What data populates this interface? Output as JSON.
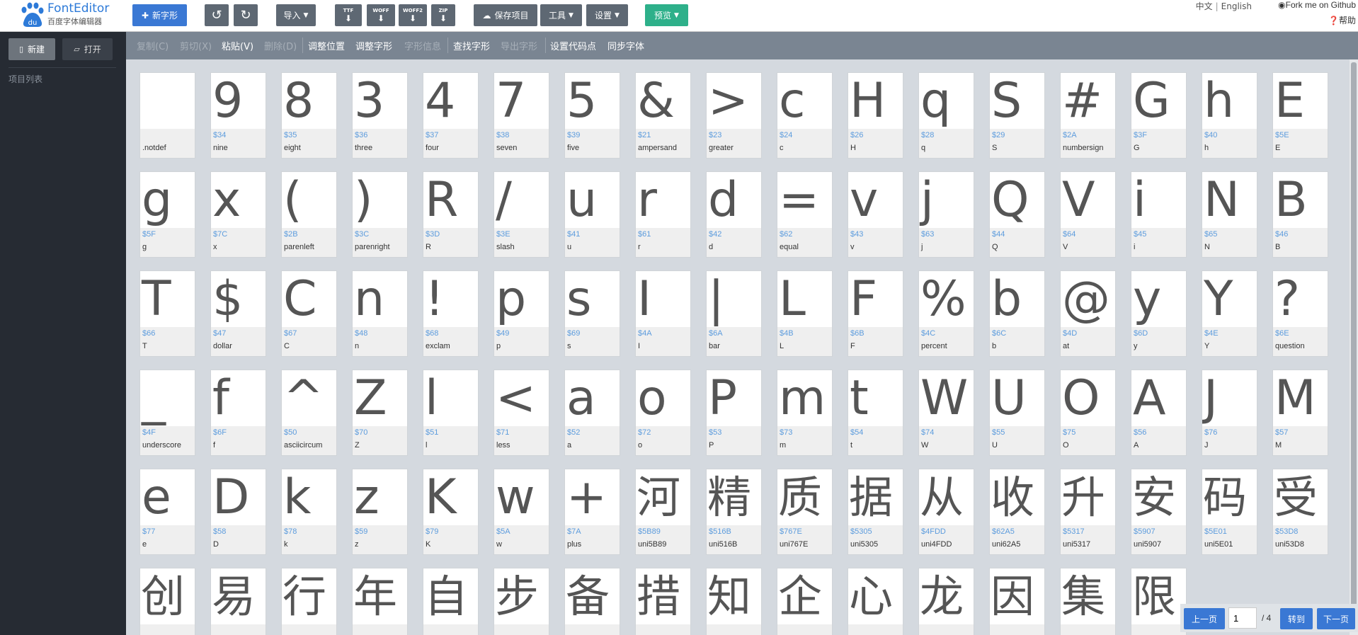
{
  "brand": {
    "name": "FontEditor",
    "subtitle": "百度字体编辑器"
  },
  "toolbar": {
    "new_glyph": "新字形",
    "undo_icon": "undo-icon",
    "redo_icon": "redo-icon",
    "import": "导入",
    "export_ttf": {
      "format": "TTF"
    },
    "export_woff": {
      "format": "WOFF"
    },
    "export_woff2": {
      "format": "WOFF2"
    },
    "export_zip": {
      "format": "ZIP"
    },
    "save_project": "保存项目",
    "tools": "工具",
    "settings": "设置",
    "preview": "预览"
  },
  "header_right": {
    "lang_cn": "中文",
    "lang_sep": "|",
    "lang_en": "English",
    "github": "Fork me on Github",
    "help": "帮助"
  },
  "sidebar": {
    "new": "新建",
    "open": "打开",
    "project_list": "项目列表"
  },
  "commands": [
    {
      "label": "复制(C)",
      "disabled": true
    },
    {
      "label": "剪切(X)",
      "disabled": true
    },
    {
      "label": "粘贴(V)",
      "disabled": false
    },
    {
      "label": "删除(D)",
      "disabled": true
    },
    {
      "label": "调整位置",
      "disabled": false
    },
    {
      "label": "调整字形",
      "disabled": false
    },
    {
      "label": "字形信息",
      "disabled": true
    },
    {
      "label": "查找字形",
      "disabled": false
    },
    {
      "label": "导出字形",
      "disabled": true
    },
    {
      "label": "设置代码点",
      "disabled": false
    },
    {
      "label": "同步字体",
      "disabled": false
    }
  ],
  "glyphs": [
    {
      "char": "",
      "code": "",
      "name": ".notdef"
    },
    {
      "char": "9",
      "code": "$34",
      "name": "nine"
    },
    {
      "char": "8",
      "code": "$35",
      "name": "eight"
    },
    {
      "char": "3",
      "code": "$36",
      "name": "three"
    },
    {
      "char": "4",
      "code": "$37",
      "name": "four"
    },
    {
      "char": "7",
      "code": "$38",
      "name": "seven"
    },
    {
      "char": "5",
      "code": "$39",
      "name": "five"
    },
    {
      "char": "&",
      "code": "$21",
      "name": "ampersand"
    },
    {
      "char": ">",
      "code": "$23",
      "name": "greater"
    },
    {
      "char": "c",
      "code": "$24",
      "name": "c"
    },
    {
      "char": "H",
      "code": "$26",
      "name": "H"
    },
    {
      "char": "q",
      "code": "$28",
      "name": "q"
    },
    {
      "char": "S",
      "code": "$29",
      "name": "S"
    },
    {
      "char": "#",
      "code": "$2A",
      "name": "numbersign"
    },
    {
      "char": "G",
      "code": "$3F",
      "name": "G"
    },
    {
      "char": "h",
      "code": "$40",
      "name": "h"
    },
    {
      "char": "E",
      "code": "$5E",
      "name": "E"
    },
    {
      "char": "g",
      "code": "$5F",
      "name": "g"
    },
    {
      "char": "x",
      "code": "$7C",
      "name": "x"
    },
    {
      "char": "(",
      "code": "$2B",
      "name": "parenleft"
    },
    {
      "char": ")",
      "code": "$3C",
      "name": "parenright"
    },
    {
      "char": "R",
      "code": "$3D",
      "name": "R"
    },
    {
      "char": "/",
      "code": "$3E",
      "name": "slash"
    },
    {
      "char": "u",
      "code": "$41",
      "name": "u"
    },
    {
      "char": "r",
      "code": "$61",
      "name": "r"
    },
    {
      "char": "d",
      "code": "$42",
      "name": "d"
    },
    {
      "char": "=",
      "code": "$62",
      "name": "equal"
    },
    {
      "char": "v",
      "code": "$43",
      "name": "v"
    },
    {
      "char": "j",
      "code": "$63",
      "name": "j"
    },
    {
      "char": "Q",
      "code": "$44",
      "name": "Q"
    },
    {
      "char": "V",
      "code": "$64",
      "name": "V"
    },
    {
      "char": "i",
      "code": "$45",
      "name": "i"
    },
    {
      "char": "N",
      "code": "$65",
      "name": "N"
    },
    {
      "char": "B",
      "code": "$46",
      "name": "B"
    },
    {
      "char": "T",
      "code": "$66",
      "name": "T"
    },
    {
      "char": "$",
      "code": "$47",
      "name": "dollar"
    },
    {
      "char": "C",
      "code": "$67",
      "name": "C"
    },
    {
      "char": "n",
      "code": "$48",
      "name": "n"
    },
    {
      "char": "!",
      "code": "$68",
      "name": "exclam"
    },
    {
      "char": "p",
      "code": "$49",
      "name": "p"
    },
    {
      "char": "s",
      "code": "$69",
      "name": "s"
    },
    {
      "char": "I",
      "code": "$4A",
      "name": "I"
    },
    {
      "char": "|",
      "code": "$6A",
      "name": "bar"
    },
    {
      "char": "L",
      "code": "$4B",
      "name": "L"
    },
    {
      "char": "F",
      "code": "$6B",
      "name": "F"
    },
    {
      "char": "%",
      "code": "$4C",
      "name": "percent"
    },
    {
      "char": "b",
      "code": "$6C",
      "name": "b"
    },
    {
      "char": "@",
      "code": "$4D",
      "name": "at"
    },
    {
      "char": "y",
      "code": "$6D",
      "name": "y"
    },
    {
      "char": "Y",
      "code": "$4E",
      "name": "Y"
    },
    {
      "char": "?",
      "code": "$6E",
      "name": "question"
    },
    {
      "char": "_",
      "code": "$4F",
      "name": "underscore"
    },
    {
      "char": "f",
      "code": "$6F",
      "name": "f"
    },
    {
      "char": "^",
      "code": "$50",
      "name": "asciicircum"
    },
    {
      "char": "Z",
      "code": "$70",
      "name": "Z"
    },
    {
      "char": "l",
      "code": "$51",
      "name": "l"
    },
    {
      "char": "<",
      "code": "$71",
      "name": "less"
    },
    {
      "char": "a",
      "code": "$52",
      "name": "a"
    },
    {
      "char": "o",
      "code": "$72",
      "name": "o"
    },
    {
      "char": "P",
      "code": "$53",
      "name": "P"
    },
    {
      "char": "m",
      "code": "$73",
      "name": "m"
    },
    {
      "char": "t",
      "code": "$54",
      "name": "t"
    },
    {
      "char": "W",
      "code": "$74",
      "name": "W"
    },
    {
      "char": "U",
      "code": "$55",
      "name": "U"
    },
    {
      "char": "O",
      "code": "$75",
      "name": "O"
    },
    {
      "char": "A",
      "code": "$56",
      "name": "A"
    },
    {
      "char": "J",
      "code": "$76",
      "name": "J"
    },
    {
      "char": "M",
      "code": "$57",
      "name": "M"
    },
    {
      "char": "e",
      "code": "$77",
      "name": "e"
    },
    {
      "char": "D",
      "code": "$58",
      "name": "D"
    },
    {
      "char": "k",
      "code": "$78",
      "name": "k"
    },
    {
      "char": "z",
      "code": "$59",
      "name": "z"
    },
    {
      "char": "K",
      "code": "$79",
      "name": "K"
    },
    {
      "char": "w",
      "code": "$5A",
      "name": "w"
    },
    {
      "char": "+",
      "code": "$7A",
      "name": "plus"
    },
    {
      "char": "河",
      "code": "$5B89",
      "name": "uni5B89"
    },
    {
      "char": "精",
      "code": "$516B",
      "name": "uni516B"
    },
    {
      "char": "质",
      "code": "$767E",
      "name": "uni767E"
    },
    {
      "char": "据",
      "code": "$5305",
      "name": "uni5305"
    },
    {
      "char": "从",
      "code": "$4FDD",
      "name": "uni4FDD"
    },
    {
      "char": "收",
      "code": "$62A5",
      "name": "uni62A5"
    },
    {
      "char": "升",
      "code": "$5317",
      "name": "uni5317"
    },
    {
      "char": "安",
      "code": "$5907",
      "name": "uni5907"
    },
    {
      "char": "码",
      "code": "$5E01",
      "name": "uni5E01"
    },
    {
      "char": "受",
      "code": "$53D8",
      "name": "uni53D8"
    },
    {
      "char": "创",
      "code": "",
      "name": ""
    },
    {
      "char": "易",
      "code": "",
      "name": ""
    },
    {
      "char": "行",
      "code": "",
      "name": ""
    },
    {
      "char": "年",
      "code": "",
      "name": ""
    },
    {
      "char": "自",
      "code": "",
      "name": ""
    },
    {
      "char": "步",
      "code": "",
      "name": ""
    },
    {
      "char": "备",
      "code": "",
      "name": ""
    },
    {
      "char": "措",
      "code": "",
      "name": ""
    },
    {
      "char": "知",
      "code": "",
      "name": ""
    },
    {
      "char": "企",
      "code": "",
      "name": ""
    },
    {
      "char": "心",
      "code": "",
      "name": ""
    },
    {
      "char": "龙",
      "code": "",
      "name": ""
    },
    {
      "char": "因",
      "code": "",
      "name": ""
    },
    {
      "char": "集",
      "code": "",
      "name": ""
    },
    {
      "char": "限",
      "code": "",
      "name": ""
    }
  ],
  "pager": {
    "prev": "上一页",
    "current": "1",
    "total": "/ 4",
    "goto": "转到",
    "next": "下一页"
  }
}
